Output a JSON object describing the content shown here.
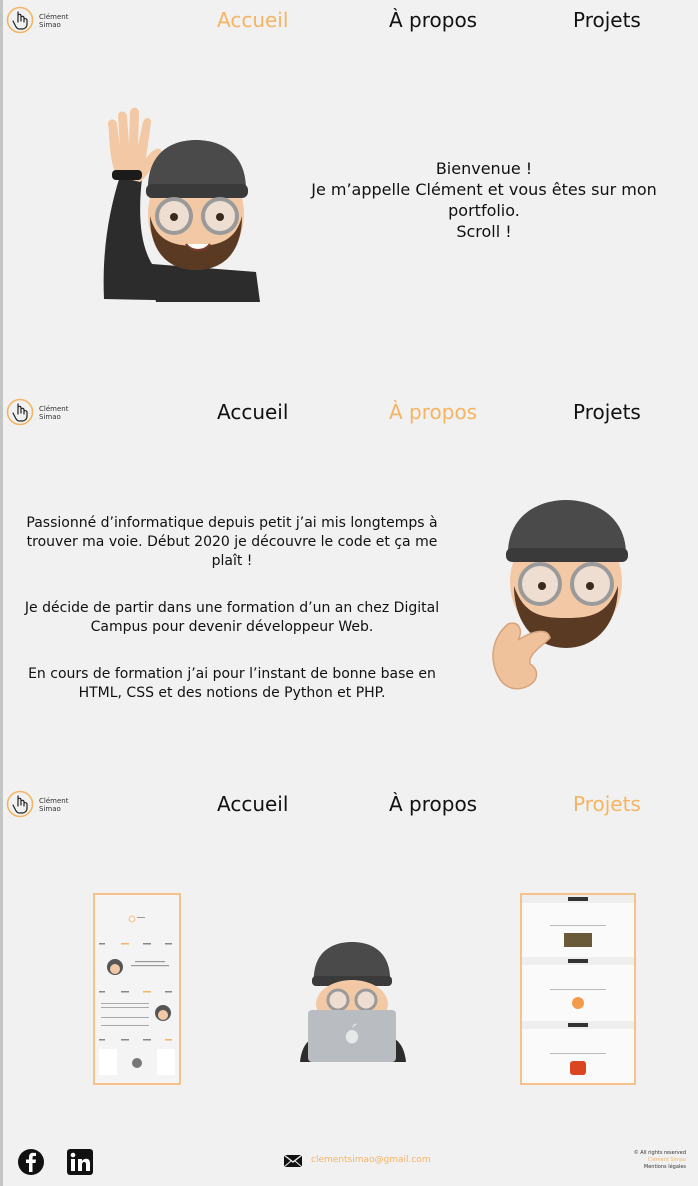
{
  "logo": {
    "line1": "Clément",
    "line2": "Simao"
  },
  "nav": {
    "accueil": "Accueil",
    "apropos": "À propos",
    "projets": "Projets"
  },
  "hero": {
    "line1": "Bienvenue !",
    "line2": "Je m’appelle Clément et vous êtes sur mon portfolio.",
    "line3": "Scroll !"
  },
  "about": {
    "p1": "Passionné d’informatique depuis petit j’ai mis longtemps à trouver ma voie. Début 2020 je découvre le code et ça me plaît !",
    "p2": "Je décide de partir dans une formation d’un an chez Digital Campus pour devenir développeur Web.",
    "p3": "En cours de formation j’ai pour l’instant de bonne base en HTML, CSS et des notions de Python et PHP."
  },
  "footer": {
    "email": "clementsimao@gmail.com",
    "legal1": "© All rights reserved",
    "legal2": "Clément Simao",
    "legal3": "Mentions légales"
  },
  "colors": {
    "accent": "#f5b462",
    "background": "#f1f1f1"
  },
  "icons": [
    "pointer-hand-icon",
    "facebook-icon",
    "linkedin-icon",
    "mail-icon"
  ]
}
